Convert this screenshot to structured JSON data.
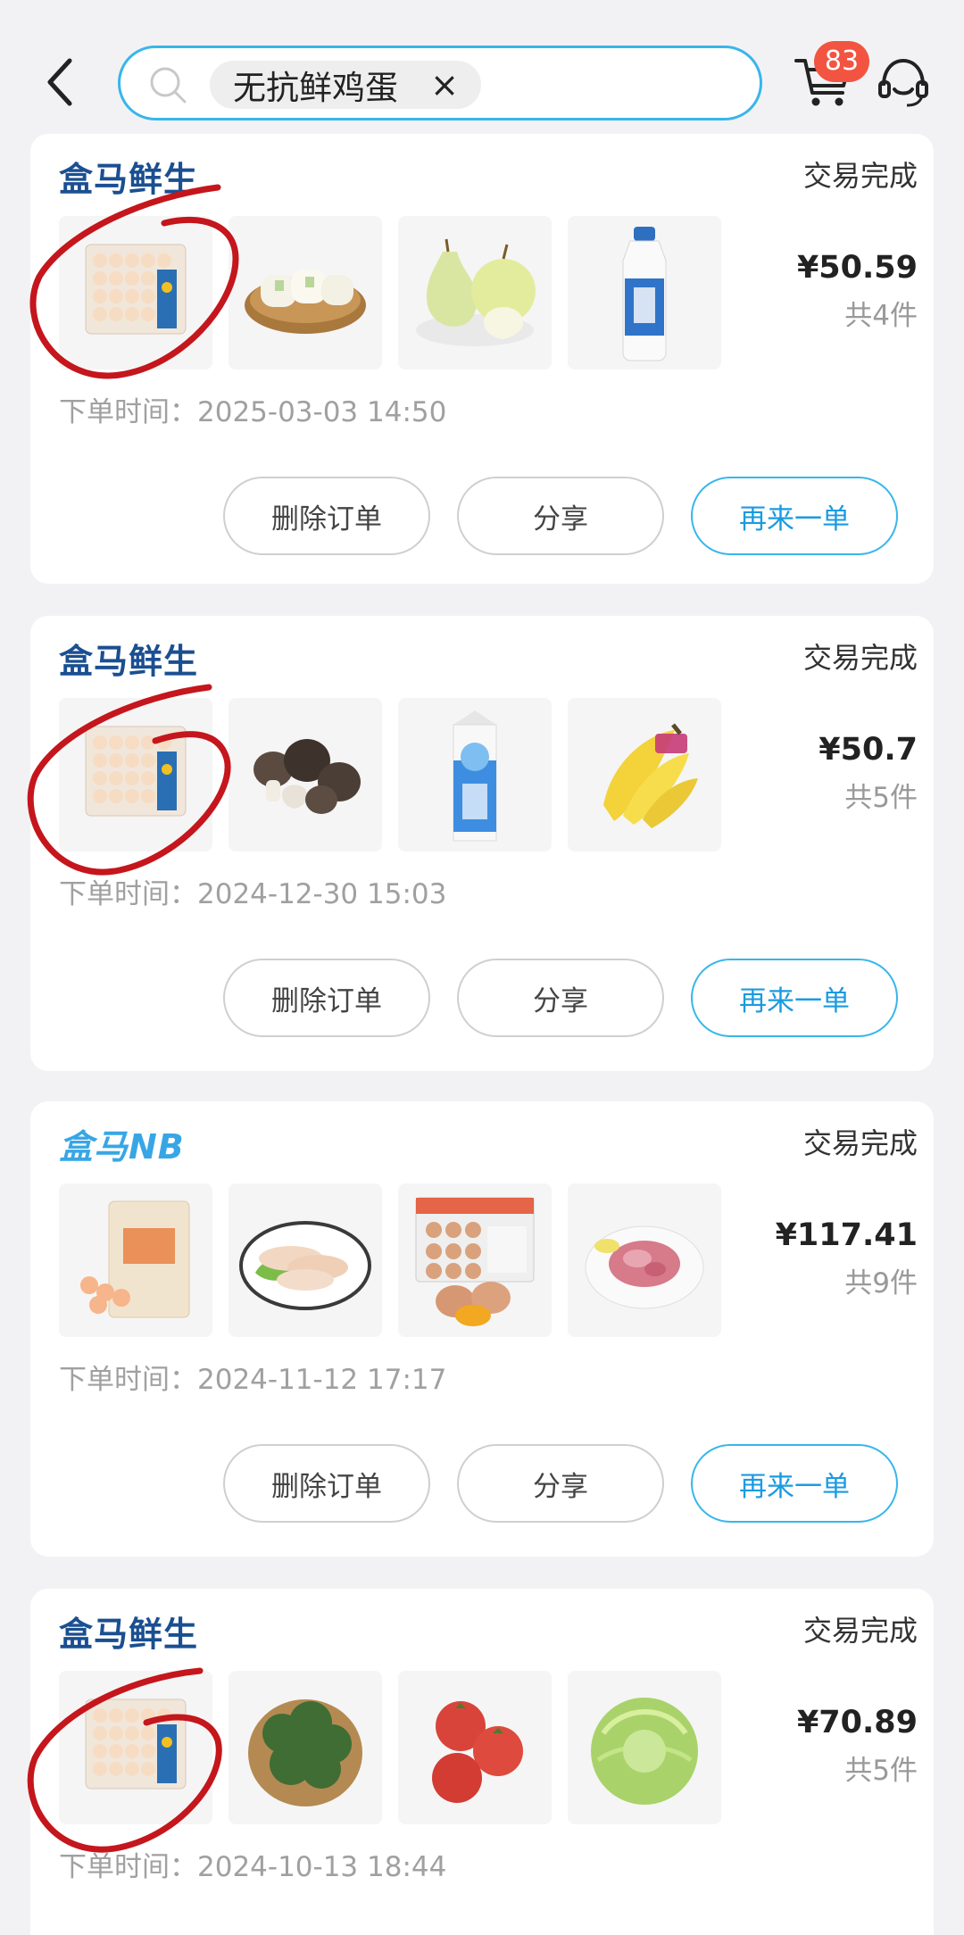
{
  "header": {
    "search_chip": "无抗鲜鸡蛋",
    "chip_close": "×",
    "cart_badge": "83"
  },
  "orders": [
    {
      "store": "盒马鲜生",
      "status": "交易完成",
      "price": "¥50.59",
      "count": "共4件",
      "time_label": "下单时间：",
      "time": "2025-03-03 14:50",
      "items": [
        "eggs-tray",
        "rice-cakes",
        "pears",
        "milk-bottle"
      ],
      "annotated": true
    },
    {
      "store": "盒马鲜生",
      "status": "交易完成",
      "price": "¥50.7",
      "count": "共5件",
      "time_label": "下单时间：",
      "time": "2024-12-30 15:03",
      "items": [
        "eggs-tray",
        "mushrooms",
        "milk-carton",
        "bananas"
      ],
      "annotated": true
    },
    {
      "store": "盒马NB",
      "status": "交易完成",
      "price": "¥117.41",
      "count": "共9件",
      "time_label": "下单时间：",
      "time": "2024-11-12 17:17",
      "items": [
        "shrimp-bag",
        "chicken-wings",
        "eggs-box",
        "minced-meat"
      ],
      "annotated": false
    },
    {
      "store": "盒马鲜生",
      "status": "交易完成",
      "price": "¥70.89",
      "count": "共5件",
      "time_label": "下单时间：",
      "time": "2024-10-13 18:44",
      "items": [
        "eggs-tray",
        "broccoli",
        "tomatoes",
        "cabbage"
      ],
      "annotated": true
    }
  ],
  "actions": {
    "delete": "删除订单",
    "share": "分享",
    "reorder": "再来一单"
  },
  "colors": {
    "accent": "#37b6ea",
    "badge": "#f25441",
    "brand_dark": "#1a4f91",
    "annotation": "#c4161c"
  }
}
